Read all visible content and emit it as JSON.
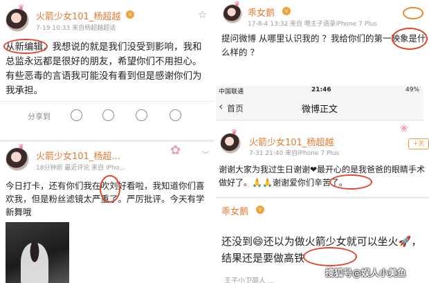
{
  "post1": {
    "username": "火箭少女101_杨超越",
    "meta": "7-19 10:33  来自杨超越超话",
    "text": "从新编辑，我想说的就是我们没受到影响，我和总监永远都是很好的朋友，希望你们不用担心。有些恶毒的言语我可能没有看到但是感谢你们为我承担。",
    "actions": {
      "share": "分享到"
    }
  },
  "post2": {
    "username": "火箭少女101_杨超...",
    "meta": "18分钟前 最近评论  来自 iPho...",
    "text": "今日打卡，还有你们我在吹刘好看啦，我知道你们喜欢我，但是粉丝滤镜太严重了。严厉批评。今天有学新舞哦"
  },
  "post3": {
    "username": "乖女鹅",
    "meta": "17-8-4 13:32  来自 嗯主子语录iPhone 7 Plus",
    "text": "提问微博 从哪里认识我的 ？我给你们的第一映象是什么样的 ？"
  },
  "phone": {
    "carrier": "中国联通",
    "time": "21:46",
    "battery": "49%",
    "back_label": "首页",
    "title": "微博正文"
  },
  "post4": {
    "username": "火箭少女101_杨超越",
    "meta": "7-31 21:40  来自iPhone 7 Plus",
    "follow_label": "+关",
    "text": "谢谢大家为我过生日谢谢❤最开心的是我爸爸的眼睛手术做好了。🙏🙏谢谢爱你们辛苦了。"
  },
  "post5": {
    "username": "乖女鹅",
    "text": "还没到😄还以为做火箭少女就可以坐火🚀，结果还是要做高铁",
    "footer": "王子小卫简人 ..."
  },
  "watermark": "搜狐号@娱人小美鱼",
  "colors": {
    "username": "#e8792f",
    "annotation": "#e0452b",
    "follow": "#f29a38"
  }
}
